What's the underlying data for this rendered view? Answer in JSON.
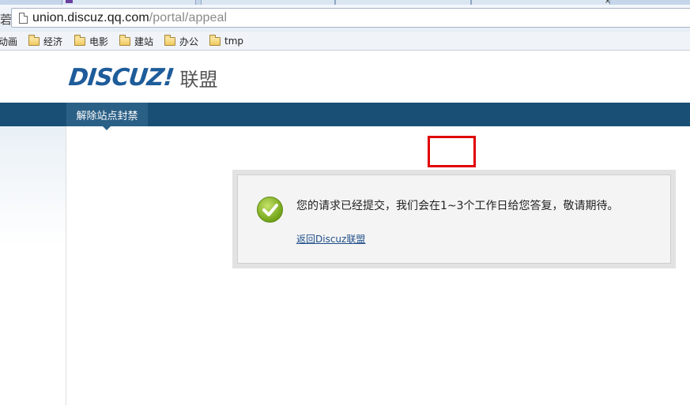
{
  "browser": {
    "url_host": "union.discuz.qq.com",
    "url_path": "/portal/appeal",
    "bookmarks": [
      {
        "label": "动画",
        "icon": "none"
      },
      {
        "label": "经济",
        "icon": "folder-icon"
      },
      {
        "label": "电影",
        "icon": "folder-icon"
      },
      {
        "label": "建站",
        "icon": "folder-icon"
      },
      {
        "label": "办公",
        "icon": "folder-icon"
      },
      {
        "label": "tmp",
        "icon": "folder-icon"
      }
    ]
  },
  "header": {
    "logo_text": "DISCUZ",
    "logo_bang": "!",
    "logo_sub": "联盟"
  },
  "nav": {
    "items": [
      {
        "label": "解除站点封禁",
        "active": true
      }
    ]
  },
  "message": {
    "text": "您的请求已经提交，我们会在1~3个工作日给您答复，敬请期待。",
    "link": "返回Discuz联盟",
    "icon": "check-circle-icon"
  },
  "annotation": {
    "color": "#e00000"
  }
}
